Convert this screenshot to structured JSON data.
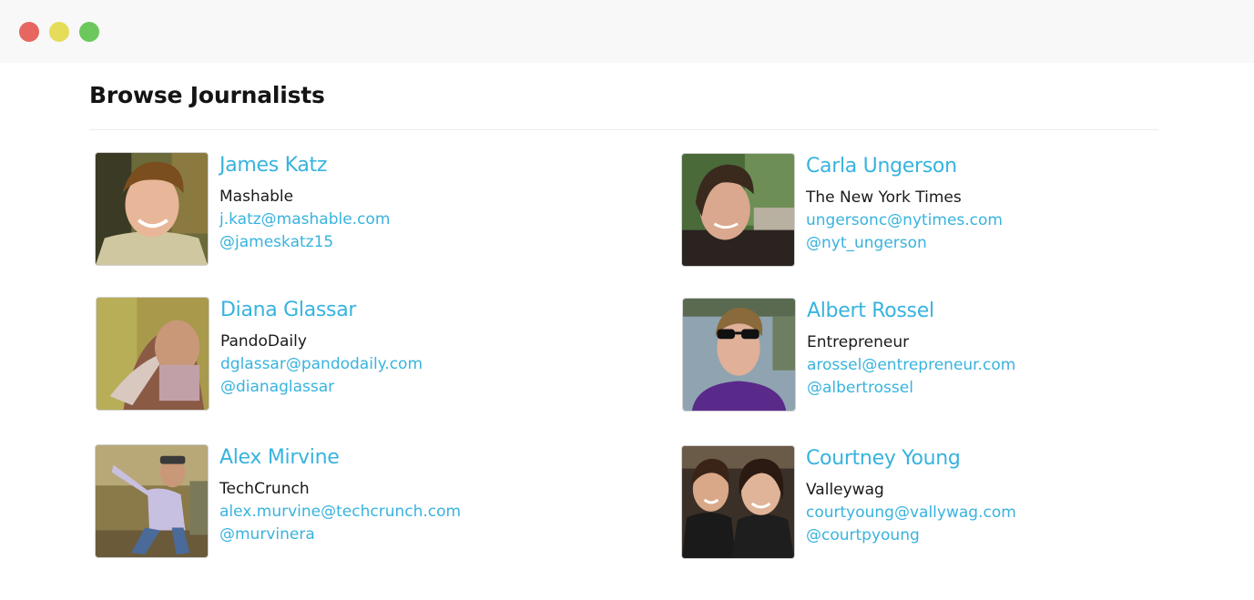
{
  "window": {
    "controls": [
      "close",
      "minimize",
      "maximize"
    ]
  },
  "page": {
    "title": "Browse Journalists"
  },
  "journalists": [
    {
      "name": "James Katz",
      "outlet": "Mashable",
      "email": "j.katz@mashable.com",
      "handle": "@jameskatz15"
    },
    {
      "name": "Carla Ungerson",
      "outlet": "The New York Times",
      "email": "ungersonc@nytimes.com",
      "handle": "@nyt_ungerson"
    },
    {
      "name": "Diana Glassar",
      "outlet": "PandoDaily",
      "email": "dglassar@pandodaily.com",
      "handle": "@dianaglassar"
    },
    {
      "name": "Albert Rossel",
      "outlet": "Entrepreneur",
      "email": "arossel@entrepreneur.com",
      "handle": "@albertrossel"
    },
    {
      "name": "Alex Mirvine",
      "outlet": "TechCrunch",
      "email": "alex.murvine@techcrunch.com",
      "handle": "@murvinera"
    },
    {
      "name": "Courtney Young",
      "outlet": "Valleywag",
      "email": "courtyoung@vallywag.com",
      "handle": "@courtpyoung"
    }
  ],
  "colors": {
    "accent": "#38b3de",
    "close": "#e5675f",
    "minimize": "#e5dc5a",
    "maximize": "#6cc85d"
  }
}
